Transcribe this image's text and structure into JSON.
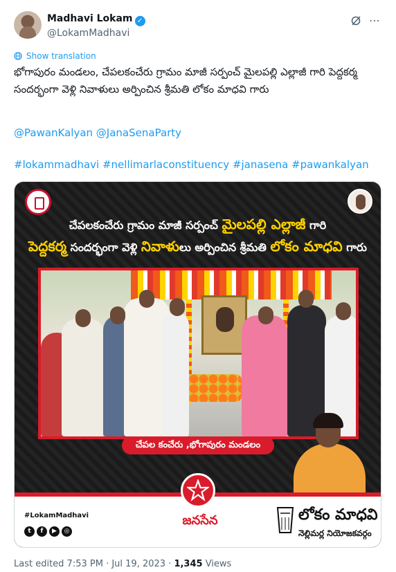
{
  "author": {
    "name": "Madhavi Lokam",
    "handle": "@LokamMadhavi",
    "verified_mark": "✓"
  },
  "actions": {
    "grok_icon": "grok-icon",
    "more_label": "⋯"
  },
  "show_translation": "Show translation",
  "post": {
    "text": "భోగాపురం మండలం, చేపలకంచేరు గ్రామం మాజీ సర్పంచ్ మైలపల్లి ఎల్లాజీ గారి పెద్దకర్మ సందర్భంగా వెళ్లి నివాళులు అర్పించిన శ్రీమతి లోకం మాధవి గారు",
    "mentions": "@PawanKalyan @JanaSenaParty",
    "hashtags": "#lokammadhavi #nellimarlaconstituency #janasena #pawankalyan"
  },
  "card": {
    "line1_pre": "చేపలకంచేరు గ్రామం మాజీ సర్పంచ్ ",
    "line1_hl": "మైలపల్లి ఎల్లాజీ",
    "line1_post": " గారి",
    "line2_hl1": "పెద్దకర్మ",
    "line2_mid1": " సందర్భంగా వెళ్లి ",
    "line2_hl2": "నివాళు",
    "line2_mid2": "లు అర్పించిన శ్రీమతి ",
    "line2_hl3": "లోకం మాధవి",
    "line2_post": " గారు",
    "location": "చేపల కంచేరు ,భోగాపురం మండలం",
    "social_handle": "#LokamMadhavi",
    "socials": [
      "t",
      "f",
      "▶",
      "◎"
    ],
    "party": "జనసేన",
    "brand": "లోకం మాధవి",
    "constituency": "నెల్లిమర్ల నియోజకవర్గం",
    "accent": "#d91c2b",
    "highlight": "#ffd200"
  },
  "meta": {
    "prefix": "Last edited 7:53 PM · Jul 19, 2023 · ",
    "views_count": "1,345",
    "views_label": " Views"
  }
}
